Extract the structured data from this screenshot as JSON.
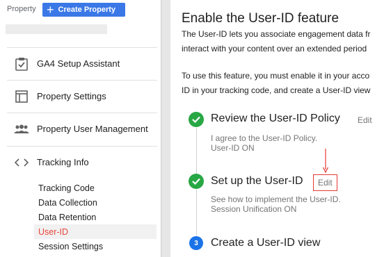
{
  "header": {
    "property_label": "Property",
    "create_button_label": "Create Property"
  },
  "sidebar": {
    "items": [
      {
        "label": "GA4 Setup Assistant",
        "icon": "clipboard-check-icon"
      },
      {
        "label": "Property Settings",
        "icon": "layout-icon"
      },
      {
        "label": "Property User Management",
        "icon": "people-icon"
      },
      {
        "label": "Tracking Info",
        "icon": "code-icon"
      }
    ],
    "tracking_sub": [
      {
        "label": "Tracking Code"
      },
      {
        "label": "Data Collection"
      },
      {
        "label": "Data Retention"
      },
      {
        "label": "User-ID"
      },
      {
        "label": "Session Settings"
      }
    ]
  },
  "main": {
    "title": "Enable the User-ID feature",
    "intro": [
      "The User-ID lets you associate engagement data fr",
      "interact with your content over an extended period"
    ],
    "instructions": [
      "To use this feature, you must enable it in your acco",
      "ID in your tracking code, and create a User-ID view"
    ],
    "steps": [
      {
        "title": "Review the User-ID Policy",
        "edit": "Edit",
        "desc": [
          "I agree to the User-ID Policy.",
          "User-ID ON"
        ]
      },
      {
        "title": "Set up the User-ID",
        "edit": "Edit",
        "desc": [
          "See how to implement the User-ID.",
          "Session Unification ON"
        ]
      },
      {
        "title": "Create a User-ID view",
        "number": "3"
      }
    ]
  },
  "colors": {
    "accent_blue": "#3b78e7",
    "check_green": "#28a745",
    "active_red": "#e8453c",
    "highlight_red": "#e53935"
  }
}
